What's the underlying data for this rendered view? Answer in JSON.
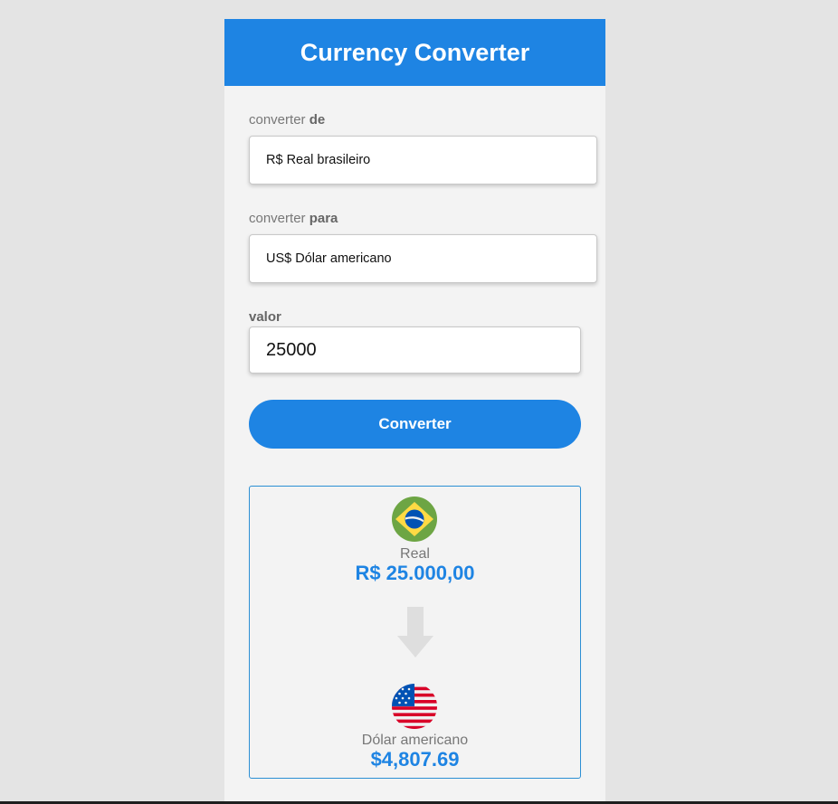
{
  "header": {
    "title": "Currency Converter"
  },
  "form": {
    "from_label_prefix": "converter ",
    "from_label_bold": "de",
    "from_value": "R$ Real brasileiro",
    "to_label_prefix": "converter ",
    "to_label_bold": "para",
    "to_value": "US$ Dólar americano",
    "amount_label": "valor",
    "amount_value": "25000",
    "convert_button": "Converter"
  },
  "result": {
    "from": {
      "flag_icon": "brazil-flag-icon",
      "name": "Real",
      "amount": "R$ 25.000,00"
    },
    "arrow_icon": "arrow-down-icon",
    "to": {
      "flag_icon": "usa-flag-icon",
      "name": "Dólar americano",
      "amount": "$4,807.69"
    }
  },
  "colors": {
    "primary": "#1e84e3",
    "page_background": "#e4e4e4",
    "card_background": "#f3f3f3",
    "result_border": "#2b8fd4"
  }
}
